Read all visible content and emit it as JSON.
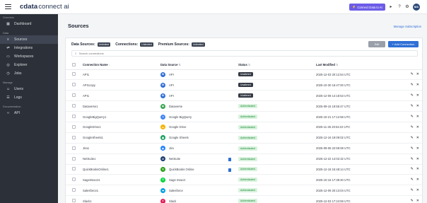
{
  "topbar": {
    "brand": "cdata",
    "product": "connect ai",
    "connect_button": "Connect Data to AI",
    "avatar": "MA",
    "colors": {
      "accent": "#6c5ce7"
    }
  },
  "sidebar": {
    "sections": [
      {
        "label": "Overview",
        "items": [
          {
            "label": "Dashboard",
            "icon": "dashboard-icon"
          }
        ]
      },
      {
        "label": "Data",
        "items": [
          {
            "label": "Sources",
            "icon": "database-icon",
            "active": true
          },
          {
            "label": "Integrations",
            "icon": "integrations-icon"
          },
          {
            "label": "Workspaces",
            "icon": "folder-icon"
          },
          {
            "label": "Explorer",
            "icon": "explorer-icon"
          },
          {
            "label": "Jobs",
            "icon": "clock-icon"
          }
        ]
      },
      {
        "label": "Manage",
        "items": [
          {
            "label": "Users",
            "icon": "users-icon"
          },
          {
            "label": "Logs",
            "icon": "logs-icon"
          }
        ]
      },
      {
        "label": "Documentation",
        "items": [
          {
            "label": "API",
            "icon": "code-icon"
          }
        ]
      }
    ]
  },
  "main": {
    "title": "Sources",
    "manage_link": "Manage Subscription",
    "counts": {
      "data_sources_label": "Data Sources:",
      "data_sources_value": "Unlimited",
      "connections_label": "Connections:",
      "connections_value": "Unlimited",
      "premium_label": "Premium Sources:",
      "premium_value": "Unlimited"
    },
    "edit_button": "Edit",
    "add_button": "+ Add Connection",
    "search_placeholder": "Search connections",
    "columns": {
      "name": "Connection Name",
      "source": "Data Source",
      "status": "Status",
      "modified": "Last Modified"
    },
    "rows": [
      {
        "name": "API1",
        "source": "API",
        "icon_color": "#2f6fd6",
        "icon_glyph": "⚙",
        "status": "Unaltered",
        "status_type": "dark",
        "modified": "2025-12-03 20:12:54 UTC"
      },
      {
        "name": "API1copy",
        "source": "API",
        "icon_color": "#2f6fd6",
        "icon_glyph": "⚙",
        "status": "Unaltered",
        "status_type": "dark",
        "modified": "2025-10-30 16:47:00 UTC"
      },
      {
        "name": "API1",
        "source": "API",
        "icon_color": "#2f6fd6",
        "icon_glyph": "⚙",
        "status": "Unaltered",
        "status_type": "dark",
        "modified": "2025-12-08 14:18:53 UTC"
      },
      {
        "name": "Dataverse1",
        "source": "Dataverse",
        "icon_color": "#3aa655",
        "icon_glyph": "◆",
        "status": "Authenticated",
        "status_type": "green",
        "modified": "2025-09-15 19:55:47 UTC"
      },
      {
        "name": "GoogleBigQuery1",
        "source": "Google BigQuery",
        "icon_color": "#4285f4",
        "icon_glyph": "●",
        "status": "Authenticated",
        "status_type": "green",
        "modified": "2025-10-21 17:12:58 UTC"
      },
      {
        "name": "GoogleDrive1",
        "source": "Google Drive",
        "icon_color": "#f4b400",
        "icon_glyph": "▲",
        "status": "Authenticated",
        "status_type": "green",
        "modified": "2025-11-25 20:54:23 UTC"
      },
      {
        "name": "GoogleSheets1",
        "source": "Google Sheets",
        "icon_color": "#0f9d58",
        "icon_glyph": "▤",
        "status": "Authenticated",
        "status_type": "green",
        "modified": "2025-12-16 19:09:02 UTC"
      },
      {
        "name": "Jira1",
        "source": "Jira",
        "icon_color": "#2684ff",
        "icon_glyph": "◆",
        "status": "Authenticated",
        "status_type": "green",
        "modified": "2025-09-06 22:59:08 UTC"
      },
      {
        "name": "NetSuite1",
        "source": "NetSuite",
        "icon_color": "#1b3b6f",
        "icon_glyph": "N",
        "status": "Authenticated",
        "status_type": "green",
        "modified": "2025-12-22 14:02:32 UTC"
      },
      {
        "name": "QuickBooksOnline1",
        "source": "QuickBooks Online",
        "icon_color": "#2ca01c",
        "icon_glyph": "q",
        "status": "Authenticated",
        "status_type": "green",
        "modified": "2025-12-18 15:48:14 UTC"
      },
      {
        "name": "SageIntacct1",
        "source": "Sage Intacct",
        "icon_color": "#00d639",
        "icon_glyph": "S",
        "status": "Authenticated",
        "status_type": "green",
        "modified": "2025-10-15 17:39:40 UTC"
      },
      {
        "name": "Salesforce1",
        "source": "Salesforce",
        "icon_color": "#00a1e0",
        "icon_glyph": "☁",
        "status": "Authenticated",
        "status_type": "green",
        "modified": "2025-12-09 20:13:04 UTC"
      },
      {
        "name": "Slack1",
        "source": "Slack",
        "icon_color": "#e01e5a",
        "icon_glyph": "#",
        "status": "Authenticated",
        "status_type": "green",
        "modified": "2025-12-03 17:24:59 UTC"
      }
    ],
    "doc_icon_rows": [
      8,
      9
    ]
  }
}
